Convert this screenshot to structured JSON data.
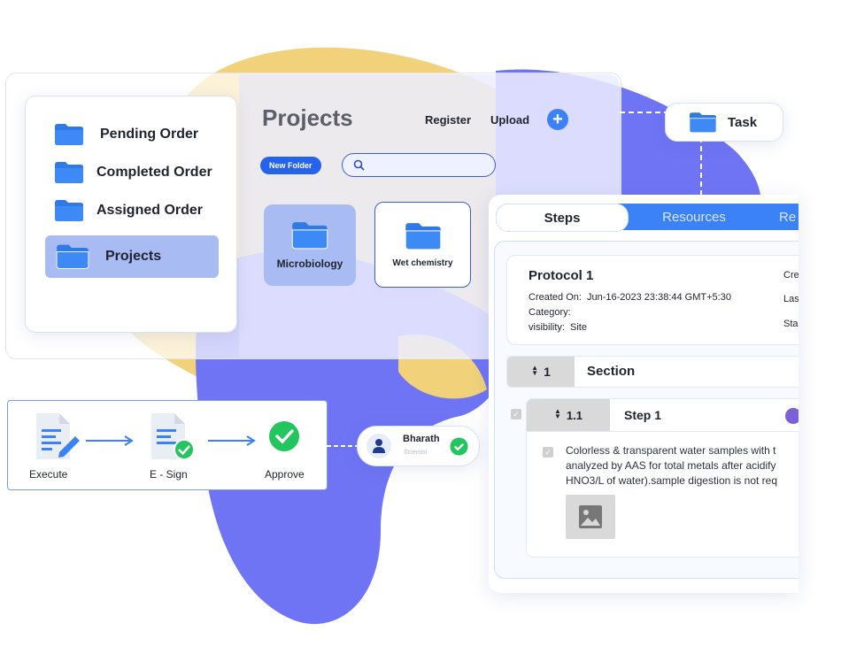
{
  "sidebar": {
    "items": [
      {
        "label": "Pending Order"
      },
      {
        "label": "Completed Order"
      },
      {
        "label": "Assigned Order"
      },
      {
        "label": "Projects",
        "active": true
      }
    ]
  },
  "projects": {
    "title": "Projects",
    "register_label": "Register",
    "upload_label": "Upload",
    "add_icon": "plus-icon",
    "new_folder_label": "New Folder",
    "search_placeholder": "",
    "folders": [
      {
        "label": "Microbiology",
        "selected": true
      },
      {
        "label": "Wet chemistry"
      }
    ]
  },
  "task": {
    "label": "Task"
  },
  "workflow": {
    "steps": [
      {
        "label": "Execute",
        "icon": "document-edit-icon"
      },
      {
        "label": "E - Sign",
        "icon": "document-check-icon"
      },
      {
        "label": "Approve",
        "icon": "check-circle-icon"
      }
    ]
  },
  "user": {
    "name": "Bharath",
    "role": "Scientist"
  },
  "protocol": {
    "tabs": [
      "Steps",
      "Resources",
      "Re"
    ],
    "title": "Protocol 1",
    "created_on_label": "Created On:",
    "created_on_value": "Jun-16-2023 23:38:44 GMT+5:30",
    "category_label": "Category:",
    "category_value": "",
    "visibility_label": "visibility:",
    "visibility_value": "Site",
    "right_col": [
      "Cre",
      "Las",
      "Sta"
    ],
    "section": {
      "number": "1",
      "label": "Section"
    },
    "step": {
      "number": "1.1",
      "label": "Step 1"
    },
    "description_lines": [
      "Colorless & transparent water samples with t",
      "analyzed by AAS for total metals after acidify",
      "HNO3/L of water).sample digestion is not  req"
    ]
  },
  "colors": {
    "accent": "#3b82f6",
    "purple": "#6f74f5",
    "yellow": "#f1d27a",
    "green": "#22c55e"
  }
}
